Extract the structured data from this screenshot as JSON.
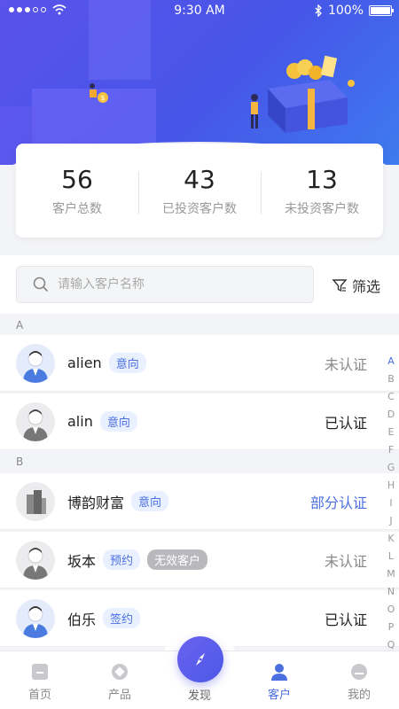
{
  "status_bar": {
    "time": "9:30 AM",
    "battery": "100%"
  },
  "stats": [
    {
      "value": "56",
      "label": "客户总数"
    },
    {
      "value": "43",
      "label": "已投资客户数"
    },
    {
      "value": "13",
      "label": "未投资客户数"
    }
  ],
  "search": {
    "placeholder": "请输入客户名称",
    "filter_label": "筛选"
  },
  "sections": [
    {
      "letter": "A"
    },
    {
      "letter": "B"
    }
  ],
  "customers": [
    {
      "name": "alien",
      "tag": "意向",
      "status": "未认证"
    },
    {
      "name": "alin",
      "tag": "意向",
      "status": "已认证"
    },
    {
      "name": "博韵财富",
      "tag": "意向",
      "status": "部分认证"
    },
    {
      "name": "坂本",
      "tag": "预约",
      "tag2": "无效客户",
      "status": "未认证"
    },
    {
      "name": "伯乐",
      "tag": "签约",
      "status": "已认证"
    }
  ],
  "alphabet": [
    "A",
    "B",
    "C",
    "D",
    "E",
    "F",
    "G",
    "H",
    "I",
    "J",
    "K",
    "L",
    "M",
    "N",
    "O",
    "P",
    "Q"
  ],
  "tabs": [
    {
      "label": "首页"
    },
    {
      "label": "产品"
    },
    {
      "label": "发现"
    },
    {
      "label": "客户"
    },
    {
      "label": "我的"
    }
  ],
  "colors": {
    "accent": "#4b6fe0",
    "hero_start": "#5a52ea",
    "hero_end": "#3e7bef"
  }
}
